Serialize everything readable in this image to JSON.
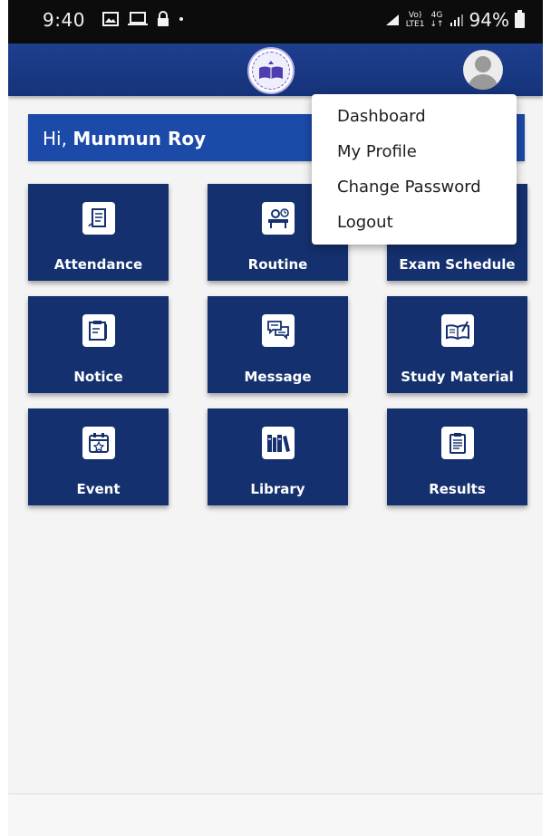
{
  "status_bar": {
    "time": "9:40",
    "network_small_top": "Vo)",
    "network_small_bottom": "LTE1",
    "network_type_top": "4G",
    "network_type_bottom": "↓↑",
    "battery": "94%"
  },
  "header": {
    "logo_icon": "institution-seal-icon",
    "avatar_icon": "user-avatar-icon"
  },
  "greeting": {
    "prefix": "Hi,",
    "name": "Munmun Roy"
  },
  "tiles": [
    {
      "label": "Attendance",
      "icon": "attendance-icon"
    },
    {
      "label": "Routine",
      "icon": "routine-icon"
    },
    {
      "label": "Exam Schedule",
      "icon": "exam-schedule-icon"
    },
    {
      "label": "Notice",
      "icon": "notice-icon"
    },
    {
      "label": "Message",
      "icon": "message-icon"
    },
    {
      "label": "Study Material",
      "icon": "study-material-icon"
    },
    {
      "label": "Event",
      "icon": "event-icon"
    },
    {
      "label": "Library",
      "icon": "library-icon"
    },
    {
      "label": "Results",
      "icon": "results-icon"
    }
  ],
  "menu": {
    "items": [
      "Dashboard",
      "My Profile",
      "Change Password",
      "Logout"
    ]
  },
  "colors": {
    "app_bar": "#1e3f8f",
    "greeting_bar": "#1b4aa8",
    "tile": "#14306e",
    "background": "#f4f4f4"
  }
}
